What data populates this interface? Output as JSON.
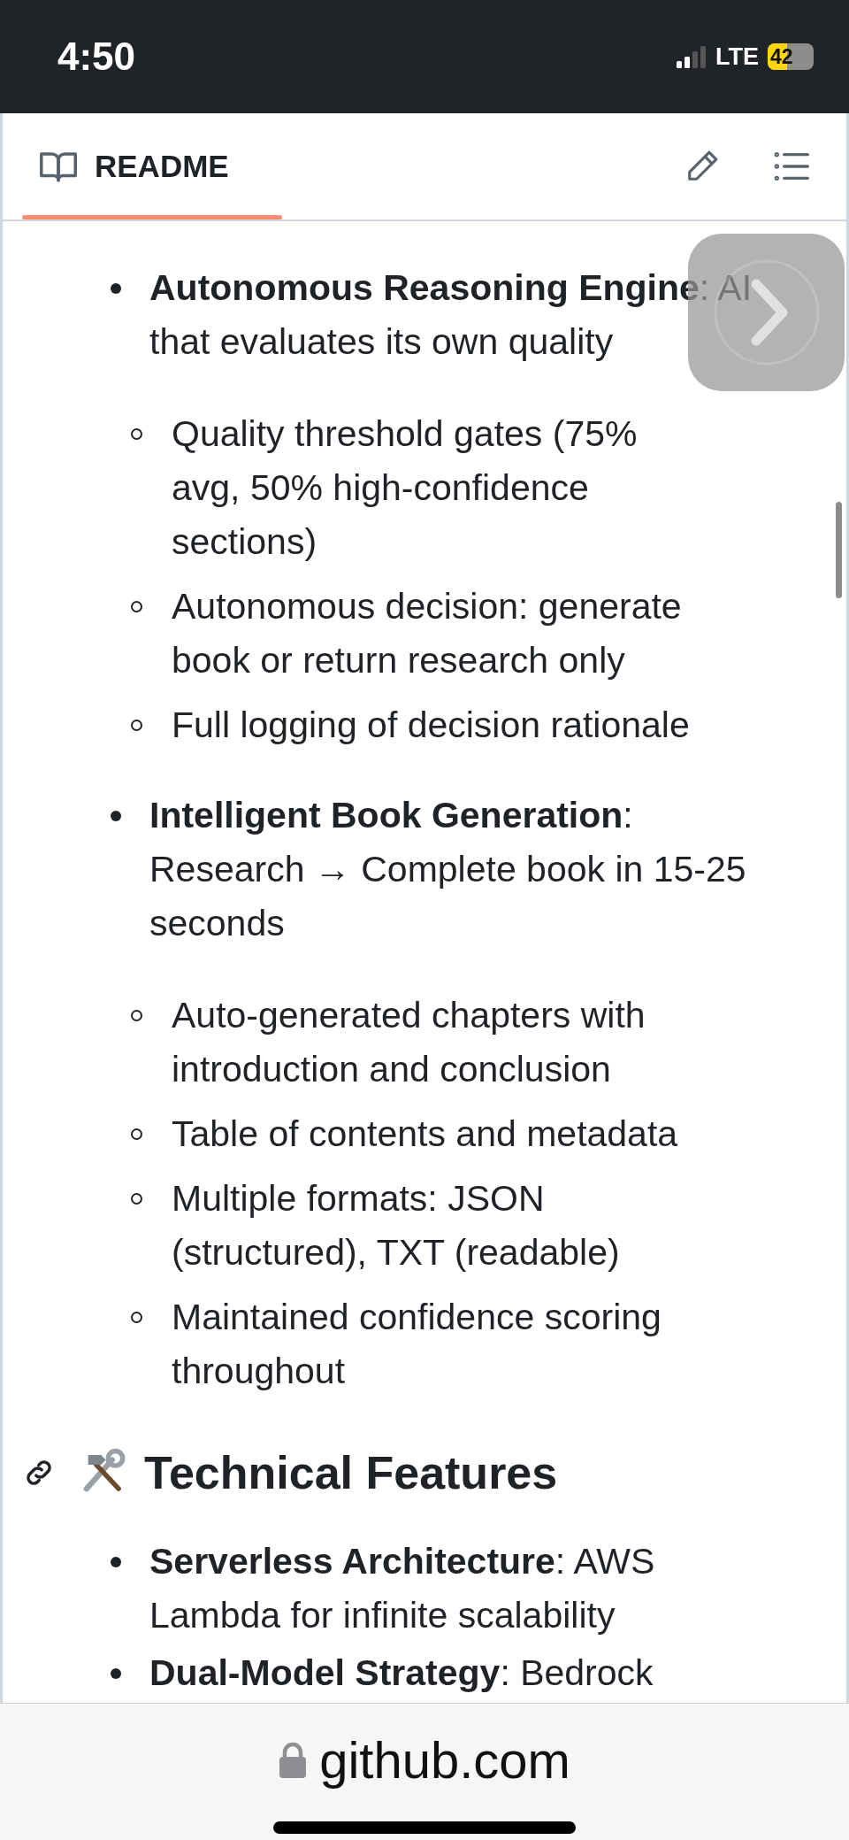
{
  "status_bar": {
    "time": "4:50",
    "network": "LTE",
    "battery": "42"
  },
  "readme_header": {
    "tab": {
      "label": "README",
      "selected": true
    }
  },
  "sections": [
    {
      "kind": "list",
      "items": [
        {
          "text": "**Autonomous Reasoning Engine**: AI\nthat evaluates its own quality",
          "children": [
            {
              "text": "Quality threshold gates (75%\navg, 50% high-confidence\nsections)"
            },
            {
              "text": "Autonomous decision: generate\nbook or return research only"
            },
            {
              "text": "Full logging of decision rationale"
            }
          ]
        },
        {
          "text": "**Intelligent Book Generation**:\nResearch → Complete book in 15-25\nseconds",
          "children": [
            {
              "text": "Auto-generated chapters with\nintroduction and conclusion"
            },
            {
              "text": "Table of contents and metadata"
            },
            {
              "text": "Multiple formats: JSON\n(structured), TXT (readable)"
            },
            {
              "text": "Maintained confidence scoring\nthroughout"
            }
          ]
        }
      ]
    },
    {
      "kind": "heading",
      "text": "Technical Features"
    },
    {
      "kind": "list",
      "items": [
        {
          "text": "**Serverless Architecture**: AWS\nLambda for infinite scalability"
        },
        {
          "text": "**Dual-Model Strategy**: Bedrock"
        }
      ]
    }
  ],
  "address_bar": {
    "domain": "github.com"
  }
}
